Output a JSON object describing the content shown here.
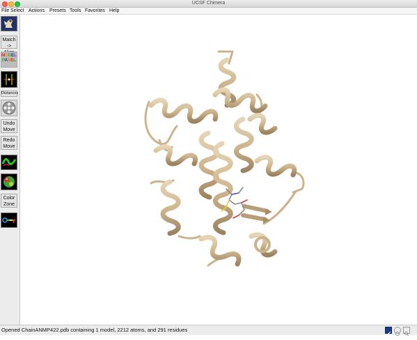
{
  "window": {
    "title": "UCSF Chimera"
  },
  "menubar": {
    "items": [
      "File",
      "Select",
      "Actions",
      "Presets",
      "Tools",
      "Favorites",
      "Help"
    ]
  },
  "toolbar": {
    "match_align": {
      "line1": "Match",
      "line2": "-> Align"
    },
    "distances": "Distances",
    "undo_move": {
      "line1": "Undo",
      "line2": "Move"
    },
    "redo_move": {
      "line1": "Redo",
      "line2": "Move"
    },
    "color_zone": {
      "line1": "Color",
      "line2": "Zone"
    },
    "model_panel_letters": [
      "M",
      "O",
      "D",
      "E",
      "L",
      "P",
      "A",
      "N",
      "E",
      "L"
    ]
  },
  "status": {
    "message": "Opened ChainANMP422.pdb containing 1 model, 2212 atoms, and 291 residues"
  },
  "colors": {
    "ribbon": "#d8c3a0",
    "ribbon_shade": "#9c8360",
    "background": "#ffffff"
  }
}
